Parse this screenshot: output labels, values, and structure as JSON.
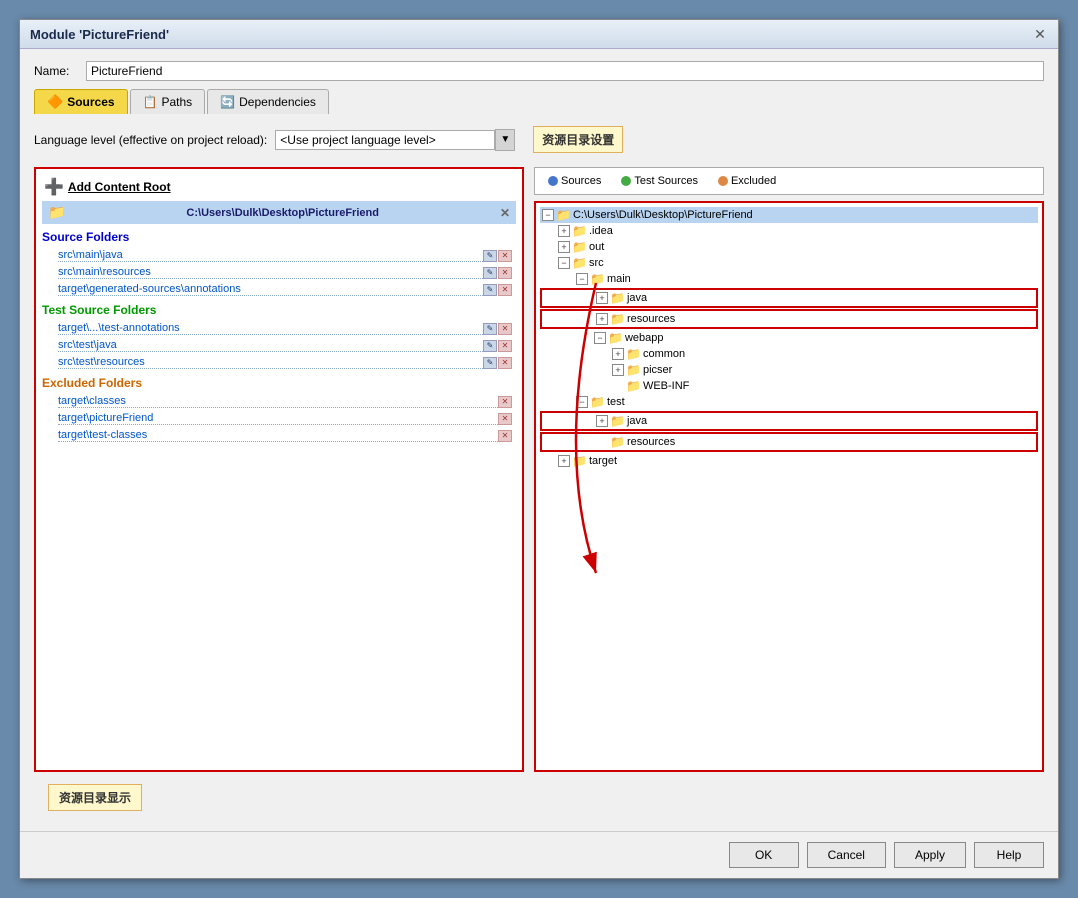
{
  "dialog": {
    "title": "Module 'PictureFriend'",
    "close_label": "✕"
  },
  "name_field": {
    "label": "Name:",
    "value": "PictureFriend"
  },
  "tabs": [
    {
      "label": "Sources",
      "icon": "sources-icon",
      "active": true
    },
    {
      "label": "Paths",
      "icon": "paths-icon",
      "active": false
    },
    {
      "label": "Dependencies",
      "icon": "dependencies-icon",
      "active": false
    }
  ],
  "language_level": {
    "label": "Language level (effective on project reload):",
    "value": "<Use project language level>"
  },
  "annotation_right": {
    "label": "资源目录设置"
  },
  "add_content_root": "Add Content Root",
  "root_path": "C:\\Users\\Dulk\\Desktop\\PictureFriend",
  "source_folders": {
    "title": "Source Folders",
    "items": [
      "src\\main\\java",
      "src\\main\\resources",
      "target\\generated-sources\\annotations"
    ]
  },
  "test_source_folders": {
    "title": "Test Source Folders",
    "items": [
      "target\\...\\test-annotations",
      "src\\test\\java",
      "src\\test\\resources"
    ]
  },
  "excluded_folders": {
    "title": "Excluded Folders",
    "items": [
      "target\\classes",
      "target\\pictureFriend",
      "target\\test-classes"
    ]
  },
  "source_type_tabs": [
    {
      "label": "Sources",
      "color": "blue"
    },
    {
      "label": "Test Sources",
      "color": "green"
    },
    {
      "label": "Excluded",
      "color": "orange"
    }
  ],
  "tree": {
    "root": "C:\\Users\\Dulk\\Desktop\\PictureFriend",
    "nodes": [
      {
        "label": ".idea",
        "indent": 1,
        "expand": true
      },
      {
        "label": "out",
        "indent": 1,
        "expand": true
      },
      {
        "label": "src",
        "indent": 1,
        "expand": true
      },
      {
        "label": "main",
        "indent": 2,
        "expand": true
      },
      {
        "label": "java",
        "indent": 3,
        "expand": true,
        "color": "blue",
        "highlighted": true
      },
      {
        "label": "resources",
        "indent": 3,
        "expand": true,
        "color": "blue",
        "highlighted": true
      },
      {
        "label": "webapp",
        "indent": 3,
        "expand": true
      },
      {
        "label": "common",
        "indent": 4,
        "expand": true
      },
      {
        "label": "picser",
        "indent": 4,
        "expand": true
      },
      {
        "label": "WEB-INF",
        "indent": 4,
        "expand": false
      },
      {
        "label": "test",
        "indent": 2,
        "expand": true
      },
      {
        "label": "java",
        "indent": 3,
        "expand": true,
        "color": "green",
        "highlighted": true
      },
      {
        "label": "resources",
        "indent": 3,
        "expand": false,
        "color": "green",
        "highlighted": true
      },
      {
        "label": "target",
        "indent": 1,
        "expand": true
      }
    ]
  },
  "annotation_bottom_left": "资源目录显示",
  "buttons": {
    "ok": "OK",
    "cancel": "Cancel",
    "apply": "Apply",
    "help": "Help"
  }
}
